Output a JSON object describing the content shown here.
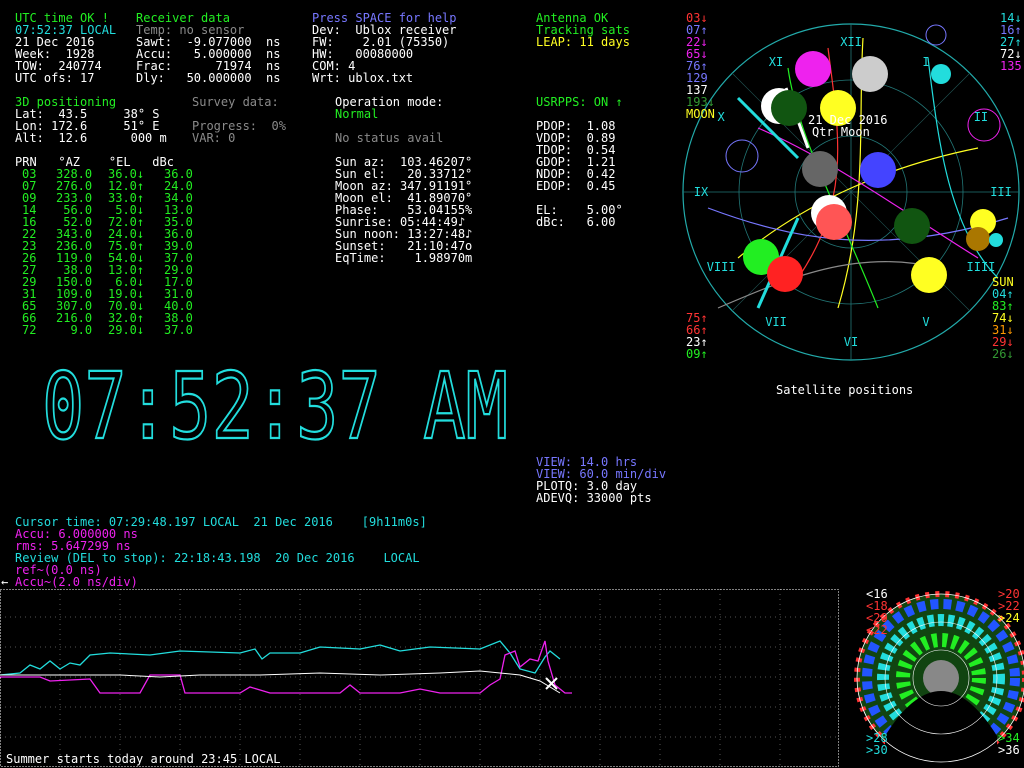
{
  "status": {
    "utc_ok": "UTC time OK !",
    "receiver_data": "Receiver data",
    "help": "Press SPACE for help",
    "antenna": "Antenna OK",
    "tracking": "Tracking sats",
    "leap": "LEAP: 11 days"
  },
  "time_block": [
    {
      "label": "07:52:37 LOCAL",
      "color": "c"
    },
    {
      "label": "21 Dec 2016",
      "color": "w"
    },
    {
      "label": "Week:  1928",
      "color": "w"
    },
    {
      "label": "TOW:  240774",
      "color": "w"
    },
    {
      "label": "UTC ofs: 17",
      "color": "w"
    }
  ],
  "receiver_block": [
    {
      "label": "Temp: no sensor",
      "color": "gr"
    },
    {
      "label": "Sawt:  -9.077000  ns",
      "color": "w"
    },
    {
      "label": "Accu:   5.000000  ns",
      "color": "w"
    },
    {
      "label": "Frac:      71974  ns",
      "color": "w"
    },
    {
      "label": "Dly:   50.000000  ns",
      "color": "w"
    }
  ],
  "device_block": [
    "Dev:  Ublox receiver",
    "FW:    2.01 (75350)",
    "HW:   00080000",
    "COM: 4",
    "Wrt: ublox.txt"
  ],
  "positioning": {
    "title": "3D positioning",
    "lat": "Lat:  43.5     38° S",
    "lon": "Lon: 172.6     51° E",
    "alt": "Alt:  12.6      000 m",
    "survey": "Survey data:",
    "progress": "Progress:  0%",
    "var": "VAR: 0"
  },
  "operation": {
    "label": "Operation mode:",
    "mode": "Normal",
    "status": "No status avail"
  },
  "usrpps": "USRPPS: ON ↑",
  "dop": [
    "PDOP:  1.08",
    "VDOP:  0.89",
    "TDOP:  0.54",
    "GDOP:  1.21",
    "NDOP:  0.42",
    "EDOP:  0.45"
  ],
  "el_mask": [
    "EL:    5.00°",
    "dBc:   6.00"
  ],
  "sun_moon": [
    "Sun az:  103.46207°",
    "Sun el:   20.33712°",
    "Moon az: 347.91191°",
    "Moon el:  41.89070°",
    "Phase:    53.04155%",
    "Sunrise: 05:44:49♪",
    "Sun noon: 13:27:48♪",
    "Sunset:   21:10:47o",
    "EqTime:    1.98970m"
  ],
  "sat_table": {
    "header": "PRN   °AZ    °EL   dBc",
    "rows": [
      {
        "prn": "03",
        "az": "328.0",
        "el": "36.0↓",
        "dbc": "36.0"
      },
      {
        "prn": "07",
        "az": "276.0",
        "el": "12.0↑",
        "dbc": "24.0"
      },
      {
        "prn": "09",
        "az": "233.0",
        "el": "33.0↑",
        "dbc": "34.0"
      },
      {
        "prn": "14",
        "az": "56.0",
        "el": "5.0↓",
        "dbc": "13.0"
      },
      {
        "prn": "16",
        "az": "52.0",
        "el": "72.0↑",
        "dbc": "35.0"
      },
      {
        "prn": "22",
        "az": "343.0",
        "el": "24.0↓",
        "dbc": "36.0"
      },
      {
        "prn": "23",
        "az": "236.0",
        "el": "75.0↑",
        "dbc": "39.0"
      },
      {
        "prn": "26",
        "az": "119.0",
        "el": "54.0↓",
        "dbc": "37.0"
      },
      {
        "prn": "27",
        "az": "38.0",
        "el": "13.0↑",
        "dbc": "29.0"
      },
      {
        "prn": "29",
        "az": "150.0",
        "el": "6.0↓",
        "dbc": "17.0"
      },
      {
        "prn": "31",
        "az": "109.0",
        "el": "19.0↓",
        "dbc": "31.0"
      },
      {
        "prn": "65",
        "az": "307.0",
        "el": "70.0↓",
        "dbc": "40.0"
      },
      {
        "prn": "66",
        "az": "216.0",
        "el": "32.0↑",
        "dbc": "38.0"
      },
      {
        "prn": "72",
        "az": "9.0",
        "el": "29.0↓",
        "dbc": "37.0"
      }
    ]
  },
  "clock": "07:52:37 AM",
  "sky": {
    "caption": "Satellite positions",
    "date": "21 Dec 2016",
    "moon_label": "Qtr Moon",
    "hours": [
      "XII",
      "I",
      "II",
      "III",
      "IIII",
      "V",
      "VI",
      "VII",
      "VIII",
      "IX",
      "X",
      "XI"
    ],
    "left_list": [
      {
        "t": "03↓",
        "c": "r"
      },
      {
        "t": "07↑",
        "c": "b"
      },
      {
        "t": "22↓",
        "c": "m"
      },
      {
        "t": "65↓",
        "c": "m"
      },
      {
        "t": "76↑",
        "c": "b"
      },
      {
        "t": "129",
        "c": "b"
      },
      {
        "t": "137",
        "c": "w"
      },
      {
        "t": "193↓",
        "c": "dg"
      },
      {
        "t": "MOON",
        "c": "y"
      }
    ],
    "right_list": [
      {
        "t": "14↓",
        "c": "c"
      },
      {
        "t": "16↑",
        "c": "b"
      },
      {
        "t": "27↑",
        "c": "c"
      },
      {
        "t": "72↓",
        "c": "w"
      },
      {
        "t": "135",
        "c": "m"
      }
    ],
    "left_bottom_list": [
      {
        "t": "75↑",
        "c": "r"
      },
      {
        "t": "66↑",
        "c": "r"
      },
      {
        "t": "23↑",
        "c": "w"
      },
      {
        "t": "09↑",
        "c": "g"
      }
    ],
    "right_bottom_list": [
      {
        "t": "SUN",
        "c": "y"
      },
      {
        "t": "04↑",
        "c": "c"
      },
      {
        "t": "83↑",
        "c": "g"
      },
      {
        "t": "74↓",
        "c": "y"
      },
      {
        "t": "31↓",
        "c": "o"
      },
      {
        "t": "29↓",
        "c": "r"
      },
      {
        "t": "26↓",
        "c": "dg"
      }
    ]
  },
  "view": {
    "hrs": "VIEW: 14.0 hrs",
    "div": "VIEW: 60.0 min/div",
    "plotq": "PLOTQ: 3.0 day",
    "adevq": "ADEVQ: 33000 pts"
  },
  "cursor": {
    "time": "Cursor time: 07:29:48.197 LOCAL  21 Dec 2016    [9h11m0s]",
    "accu": "Accu: 6.000000 ns",
    "rms": "rms: 5.647299 ns",
    "review": "Review (DEL to stop): 22:18:43.198  20 Dec 2016    LOCAL",
    "ref": "ref~(0.0 ns)",
    "scale": "Accu~(2.0 ns/div)"
  },
  "footer": "Summer starts today around 23:45 LOCAL",
  "mini_sky": {
    "left": [
      {
        "t": "<16",
        "c": "w"
      },
      {
        "t": "<18",
        "c": "r"
      },
      {
        "t": "<20",
        "c": "r"
      },
      {
        "t": "<22",
        "c": "r"
      },
      {
        "t": ">28",
        "c": "c"
      },
      {
        "t": ">30",
        "c": "c"
      }
    ],
    "right": [
      {
        "t": ">20",
        "c": "r"
      },
      {
        "t": ">22",
        "c": "r"
      },
      {
        "t": ">24",
        "c": "y"
      },
      {
        "t": ">34",
        "c": "g"
      },
      {
        "t": ">36",
        "c": "w"
      }
    ]
  },
  "colors": {
    "cyan": "#22dddd",
    "magenta": "#ee22ee",
    "green": "#22ee22",
    "yellow": "#ffff22",
    "blue": "#7777ff"
  }
}
